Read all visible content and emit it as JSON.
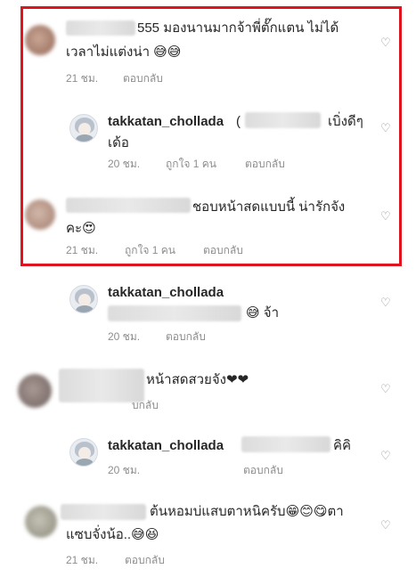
{
  "comments": [
    {
      "text_line1": "555 มองนานมากจ้าพี่ตั๊กแตน ไม่ได้",
      "text_line2": "เวลาไม่แต่งน่า 😅😅",
      "time": "21 ชม.",
      "reply": "ตอบกลับ"
    },
    {
      "username": "takkatan_chollada",
      "text_line1": "เบิ่งดีๆ",
      "text_line2": "เด้อ",
      "time": "20 ชม.",
      "likes": "ถูกใจ 1 คน",
      "reply": "ตอบกลับ"
    },
    {
      "text_line1": "ชอบหน้าสดแบบนี้ น่ารักจัง",
      "text_line2": "คะ😍",
      "time": "21 ชม.",
      "likes": "ถูกใจ 1 คน",
      "reply": "ตอบกลับ"
    },
    {
      "username": "takkatan_chollada",
      "text_line2": "😅 จ้า",
      "time": "20 ชม.",
      "reply": "ตอบกลับ"
    },
    {
      "text_line1": "หน้าสดสวยจัง❤❤",
      "reply": "บกลับ"
    },
    {
      "username": "takkatan_chollada",
      "text_line1": "คิคิ",
      "time": "20 ชม.",
      "reply": "ตอบกลับ"
    },
    {
      "text_line1": "ต้นหอมบ่แสบตาหนิครับ😁😊😋ตา",
      "text_line2": "แซบจั่งน้อ..😅😆",
      "time": "21 ชม.",
      "reply": "ตอบกลับ"
    }
  ],
  "icons": {
    "heart": "heart-outline-icon"
  },
  "colors": {
    "highlight_border": "#e0141e",
    "meta_text": "#8e8e8e"
  }
}
